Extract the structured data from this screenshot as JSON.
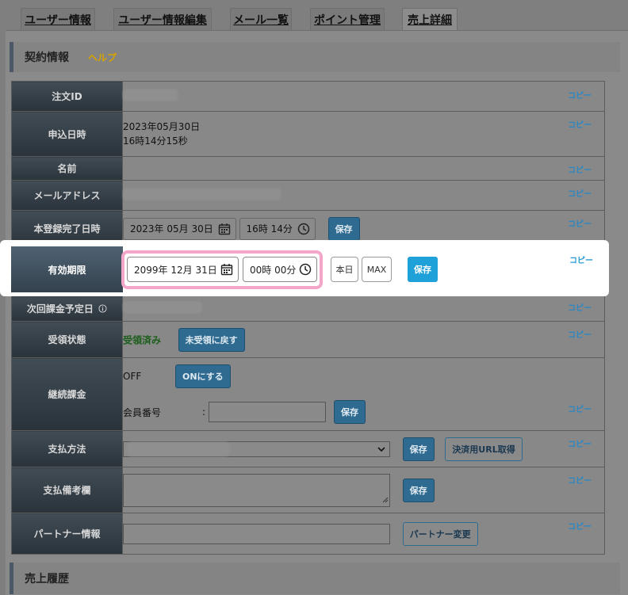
{
  "tabs": [
    {
      "label": "ユーザー情報"
    },
    {
      "label": "ユーザー情報編集"
    },
    {
      "label": "メール一覧"
    },
    {
      "label": "ポイント管理"
    },
    {
      "label": "売上詳細",
      "active": true
    }
  ],
  "contract": {
    "title": "契約情報",
    "help": "ヘルプ",
    "copy_label": "コピー",
    "rows": {
      "order_id": {
        "label": "注文ID"
      },
      "applied_at": {
        "label": "申込日時",
        "date": "2023年05月30日",
        "time": "16時14分15秒"
      },
      "name": {
        "label": "名前"
      },
      "email": {
        "label": "メールアドレス"
      },
      "registered_at": {
        "label": "本登録完了日時",
        "date": "2023年 05月 30日",
        "time": "16時 14分",
        "save": "保存"
      },
      "expiry": {
        "label": "有効期限",
        "date": "2099年 12月 31日",
        "time": "00時 00分",
        "today": "本日",
        "max": "MAX",
        "save": "保存"
      },
      "next_billing": {
        "label": "次回課金予定日"
      },
      "receipt": {
        "label": "受領状態",
        "status": "受領済み",
        "button": "未受領に戻す"
      },
      "recurring": {
        "label": "継続課金",
        "state": "OFF",
        "button": "ONにする",
        "member_no_label": "会員番号",
        "colon": ":",
        "save": "保存"
      },
      "payment": {
        "label": "支払方法",
        "save": "保存",
        "url_button": "決済用URL取得"
      },
      "payment_note": {
        "label": "支払備考欄",
        "save": "保存"
      },
      "partner": {
        "label": "パートナー情報",
        "button": "パートナー変更"
      }
    }
  },
  "sales_history": {
    "title": "売上履歴"
  },
  "colors": {
    "accent_blue": "#1ea0d8",
    "highlight_pink": "#f3a6c8",
    "status_green": "#1b7a1b",
    "help_yellow": "#d6a300"
  }
}
